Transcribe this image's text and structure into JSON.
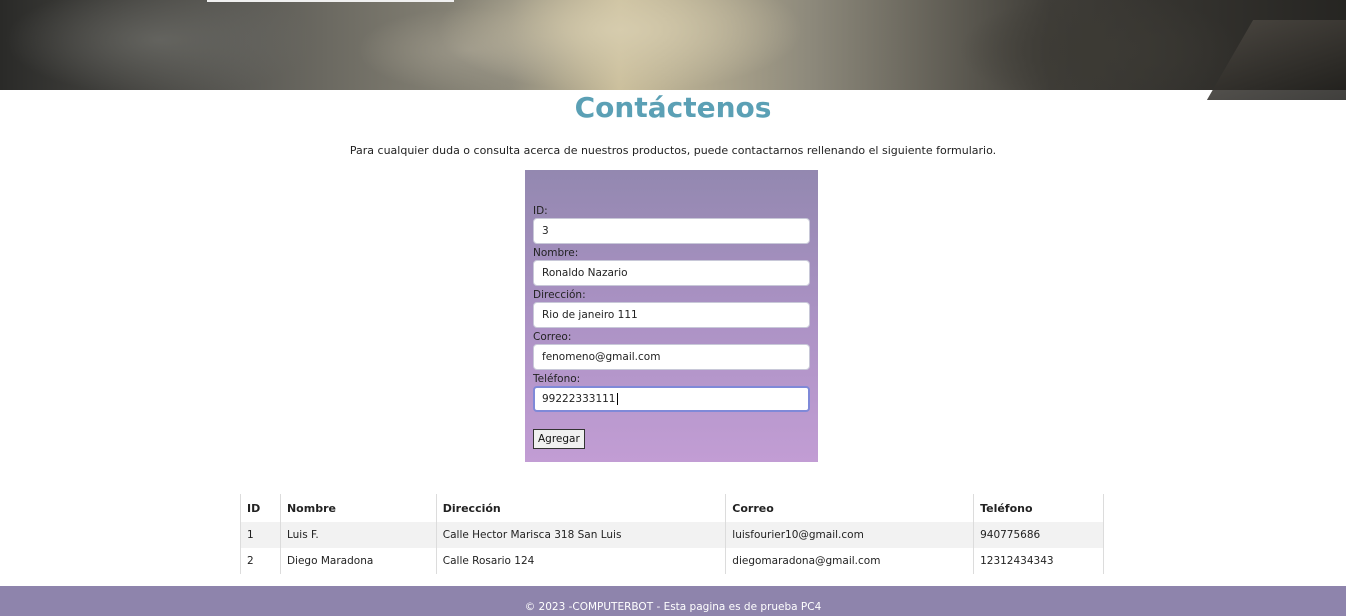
{
  "page": {
    "title": "Contáctenos",
    "intro": "Para cualquier duda o consulta acerca de nuestros productos, puede contactarnos rellenando el siguiente formulario."
  },
  "form": {
    "id_label": "ID:",
    "id_value": "3",
    "nombre_label": "Nombre:",
    "nombre_value": "Ronaldo Nazario",
    "direccion_label": "Dirección:",
    "direccion_value": "Rio de janeiro 111",
    "correo_label": "Correo:",
    "correo_value": "fenomeno@gmail.com",
    "telefono_label": "Teléfono:",
    "telefono_value": "99222333111",
    "submit_label": "Agregar"
  },
  "table": {
    "headers": [
      "ID",
      "Nombre",
      "Dirección",
      "Correo",
      "Teléfono"
    ],
    "rows": [
      [
        "1",
        "Luis F.",
        "Calle Hector Marisca 318 San Luis",
        "luisfourier10@gmail.com",
        "940775686"
      ],
      [
        "2",
        "Diego Maradona",
        "Calle Rosario 124",
        "diegomaradona@gmail.com",
        "12312434343"
      ]
    ]
  },
  "footer": {
    "text": "© 2023 -COMPUTERBOT - Esta pagina es de prueba PC4"
  }
}
